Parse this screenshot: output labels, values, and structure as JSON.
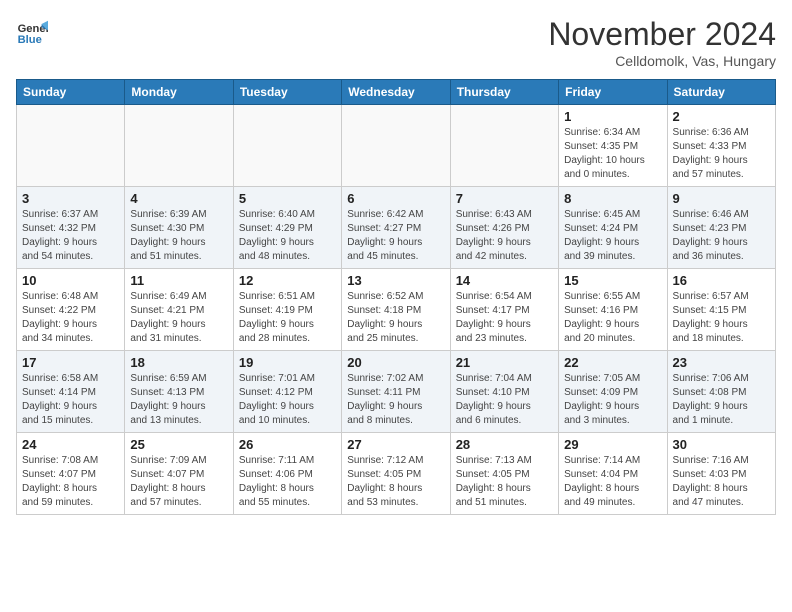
{
  "logo": {
    "line1": "General",
    "line2": "Blue"
  },
  "title": "November 2024",
  "subtitle": "Celldomolk, Vas, Hungary",
  "days_of_week": [
    "Sunday",
    "Monday",
    "Tuesday",
    "Wednesday",
    "Thursday",
    "Friday",
    "Saturday"
  ],
  "weeks": [
    [
      {
        "num": "",
        "info": ""
      },
      {
        "num": "",
        "info": ""
      },
      {
        "num": "",
        "info": ""
      },
      {
        "num": "",
        "info": ""
      },
      {
        "num": "",
        "info": ""
      },
      {
        "num": "1",
        "info": "Sunrise: 6:34 AM\nSunset: 4:35 PM\nDaylight: 10 hours\nand 0 minutes."
      },
      {
        "num": "2",
        "info": "Sunrise: 6:36 AM\nSunset: 4:33 PM\nDaylight: 9 hours\nand 57 minutes."
      }
    ],
    [
      {
        "num": "3",
        "info": "Sunrise: 6:37 AM\nSunset: 4:32 PM\nDaylight: 9 hours\nand 54 minutes."
      },
      {
        "num": "4",
        "info": "Sunrise: 6:39 AM\nSunset: 4:30 PM\nDaylight: 9 hours\nand 51 minutes."
      },
      {
        "num": "5",
        "info": "Sunrise: 6:40 AM\nSunset: 4:29 PM\nDaylight: 9 hours\nand 48 minutes."
      },
      {
        "num": "6",
        "info": "Sunrise: 6:42 AM\nSunset: 4:27 PM\nDaylight: 9 hours\nand 45 minutes."
      },
      {
        "num": "7",
        "info": "Sunrise: 6:43 AM\nSunset: 4:26 PM\nDaylight: 9 hours\nand 42 minutes."
      },
      {
        "num": "8",
        "info": "Sunrise: 6:45 AM\nSunset: 4:24 PM\nDaylight: 9 hours\nand 39 minutes."
      },
      {
        "num": "9",
        "info": "Sunrise: 6:46 AM\nSunset: 4:23 PM\nDaylight: 9 hours\nand 36 minutes."
      }
    ],
    [
      {
        "num": "10",
        "info": "Sunrise: 6:48 AM\nSunset: 4:22 PM\nDaylight: 9 hours\nand 34 minutes."
      },
      {
        "num": "11",
        "info": "Sunrise: 6:49 AM\nSunset: 4:21 PM\nDaylight: 9 hours\nand 31 minutes."
      },
      {
        "num": "12",
        "info": "Sunrise: 6:51 AM\nSunset: 4:19 PM\nDaylight: 9 hours\nand 28 minutes."
      },
      {
        "num": "13",
        "info": "Sunrise: 6:52 AM\nSunset: 4:18 PM\nDaylight: 9 hours\nand 25 minutes."
      },
      {
        "num": "14",
        "info": "Sunrise: 6:54 AM\nSunset: 4:17 PM\nDaylight: 9 hours\nand 23 minutes."
      },
      {
        "num": "15",
        "info": "Sunrise: 6:55 AM\nSunset: 4:16 PM\nDaylight: 9 hours\nand 20 minutes."
      },
      {
        "num": "16",
        "info": "Sunrise: 6:57 AM\nSunset: 4:15 PM\nDaylight: 9 hours\nand 18 minutes."
      }
    ],
    [
      {
        "num": "17",
        "info": "Sunrise: 6:58 AM\nSunset: 4:14 PM\nDaylight: 9 hours\nand 15 minutes."
      },
      {
        "num": "18",
        "info": "Sunrise: 6:59 AM\nSunset: 4:13 PM\nDaylight: 9 hours\nand 13 minutes."
      },
      {
        "num": "19",
        "info": "Sunrise: 7:01 AM\nSunset: 4:12 PM\nDaylight: 9 hours\nand 10 minutes."
      },
      {
        "num": "20",
        "info": "Sunrise: 7:02 AM\nSunset: 4:11 PM\nDaylight: 9 hours\nand 8 minutes."
      },
      {
        "num": "21",
        "info": "Sunrise: 7:04 AM\nSunset: 4:10 PM\nDaylight: 9 hours\nand 6 minutes."
      },
      {
        "num": "22",
        "info": "Sunrise: 7:05 AM\nSunset: 4:09 PM\nDaylight: 9 hours\nand 3 minutes."
      },
      {
        "num": "23",
        "info": "Sunrise: 7:06 AM\nSunset: 4:08 PM\nDaylight: 9 hours\nand 1 minute."
      }
    ],
    [
      {
        "num": "24",
        "info": "Sunrise: 7:08 AM\nSunset: 4:07 PM\nDaylight: 8 hours\nand 59 minutes."
      },
      {
        "num": "25",
        "info": "Sunrise: 7:09 AM\nSunset: 4:07 PM\nDaylight: 8 hours\nand 57 minutes."
      },
      {
        "num": "26",
        "info": "Sunrise: 7:11 AM\nSunset: 4:06 PM\nDaylight: 8 hours\nand 55 minutes."
      },
      {
        "num": "27",
        "info": "Sunrise: 7:12 AM\nSunset: 4:05 PM\nDaylight: 8 hours\nand 53 minutes."
      },
      {
        "num": "28",
        "info": "Sunrise: 7:13 AM\nSunset: 4:05 PM\nDaylight: 8 hours\nand 51 minutes."
      },
      {
        "num": "29",
        "info": "Sunrise: 7:14 AM\nSunset: 4:04 PM\nDaylight: 8 hours\nand 49 minutes."
      },
      {
        "num": "30",
        "info": "Sunrise: 7:16 AM\nSunset: 4:03 PM\nDaylight: 8 hours\nand 47 minutes."
      }
    ]
  ]
}
